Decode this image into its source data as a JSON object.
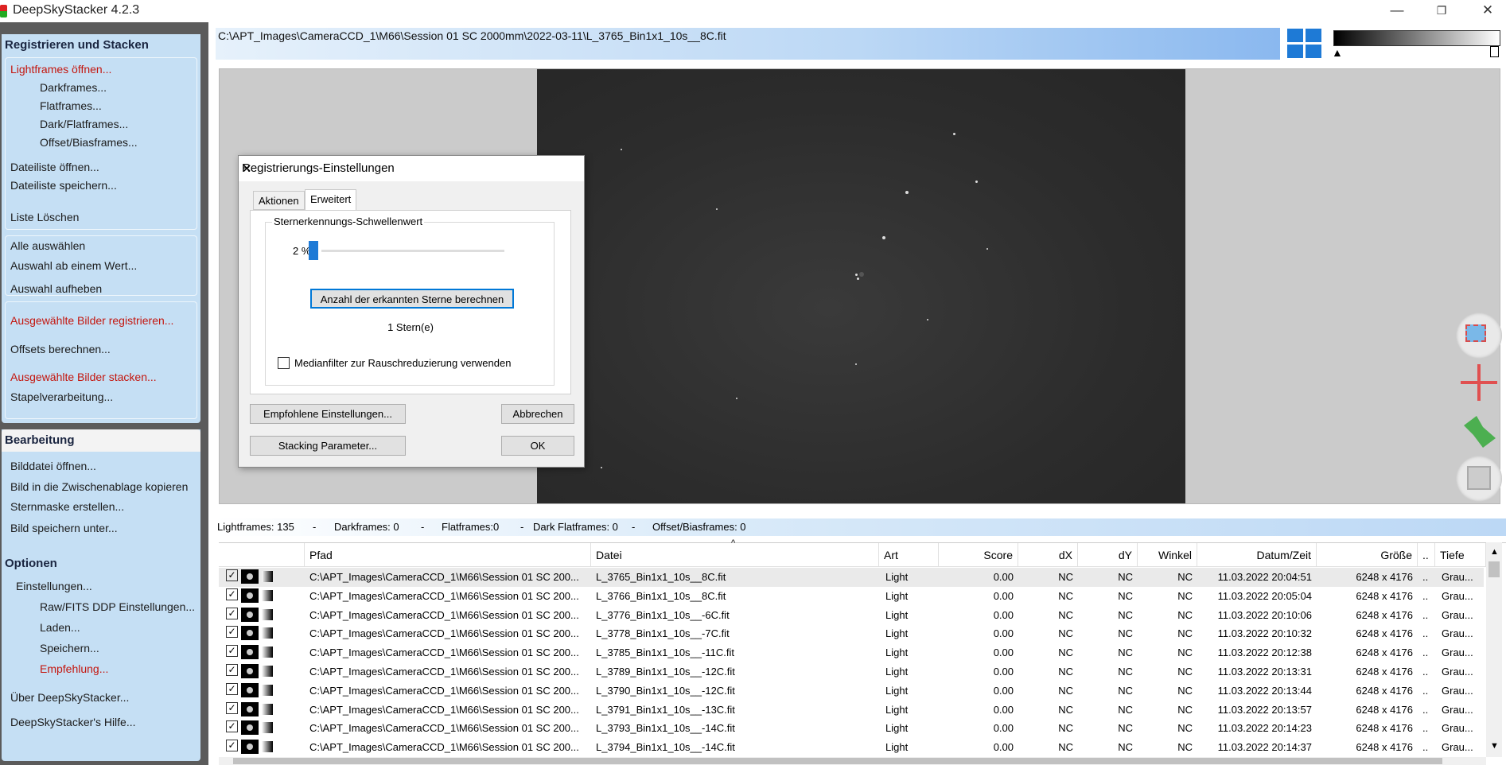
{
  "window": {
    "title": "DeepSkyStacker 4.2.3",
    "controls": [
      "—",
      "❐",
      "✕"
    ]
  },
  "left_panel": {
    "register": {
      "title": "Registrieren und Stacken",
      "open_lights": "Lightframes öffnen...",
      "darks": "Darkframes...",
      "flats": "Flatframes...",
      "darkflats": "Dark/Flatframes...",
      "offsets": "Offset/Biasframes...",
      "open_list": "Dateiliste öffnen...",
      "save_list": "Dateiliste speichern...",
      "clear_list": "Liste Löschen",
      "select_all": "Alle auswählen",
      "select_from": "Auswahl ab einem Wert...",
      "deselect": "Auswahl aufheben",
      "register_selected": "Ausgewählte Bilder registrieren...",
      "compute_offsets": "Offsets berechnen...",
      "stack_selected": "Ausgewählte Bilder stacken...",
      "batch": "Stapelverarbeitung..."
    },
    "edit": {
      "title": "Bearbeitung",
      "open_image": "Bilddatei öffnen...",
      "copy_clipboard": "Bild in die Zwischenablage kopieren",
      "star_mask": "Sternmaske erstellen...",
      "save_image": "Bild speichern unter..."
    },
    "options": {
      "title": "Optionen",
      "settings": "Einstellungen...",
      "raw_settings": "Raw/FITS DDP Einstellungen...",
      "load": "Laden...",
      "save": "Speichern...",
      "recommend": "Empfehlung...",
      "about": "Über DeepSkyStacker...",
      "help": "DeepSkyStacker's Hilfe..."
    }
  },
  "path_bar": "C:\\APT_Images\\CameraCCD_1\\M66\\Session 01 SC 2000mm\\2022-03-11\\L_3765_Bin1x1_10s__8C.fit",
  "dialog": {
    "title": "Registrierungs-Einstellungen",
    "tab_actions": "Aktionen",
    "tab_advanced": "Erweitert",
    "group_title": "Sternerkennungs-Schwellenwert",
    "threshold_value": "2 %",
    "threshold_level": 0.02,
    "compute_button": "Anzahl der erkannten Sterne berechnen",
    "stars_result": "1 Stern(e)",
    "median_filter": "Medianfilter zur Rauschreduzierung verwenden",
    "recommended_button": "Empfohlene Einstellungen...",
    "cancel_button": "Abbrechen",
    "stacking_button": "Stacking Parameter...",
    "ok_button": "OK"
  },
  "status": {
    "lights": "Lightframes: 135",
    "darks": "Darkframes: 0",
    "flats": "Flatframes:0",
    "darkflats": "Dark Flatframes: 0",
    "offsets": "Offset/Biasframes: 0",
    "sep": "-"
  },
  "table": {
    "headers": {
      "path": "Pfad",
      "file": "Datei",
      "type": "Art",
      "score": "Score",
      "dx": "dX",
      "dy": "dY",
      "angle": "Winkel",
      "datetime": "Datum/Zeit",
      "size": "Größe",
      "more": "..",
      "depth": "Tiefe"
    },
    "rows": [
      {
        "path": "C:\\APT_Images\\CameraCCD_1\\M66\\Session 01 SC 200...",
        "file": "L_3765_Bin1x1_10s__8C.fit",
        "type": "Light",
        "score": "0.00",
        "dx": "NC",
        "dy": "NC",
        "angle": "NC",
        "datetime": "11.03.2022 20:04:51",
        "size": "6248 x 4176",
        "more": "..",
        "depth": "Grau..."
      },
      {
        "path": "C:\\APT_Images\\CameraCCD_1\\M66\\Session 01 SC 200...",
        "file": "L_3766_Bin1x1_10s__8C.fit",
        "type": "Light",
        "score": "0.00",
        "dx": "NC",
        "dy": "NC",
        "angle": "NC",
        "datetime": "11.03.2022 20:05:04",
        "size": "6248 x 4176",
        "more": "..",
        "depth": "Grau..."
      },
      {
        "path": "C:\\APT_Images\\CameraCCD_1\\M66\\Session 01 SC 200...",
        "file": "L_3776_Bin1x1_10s__-6C.fit",
        "type": "Light",
        "score": "0.00",
        "dx": "NC",
        "dy": "NC",
        "angle": "NC",
        "datetime": "11.03.2022 20:10:06",
        "size": "6248 x 4176",
        "more": "..",
        "depth": "Grau..."
      },
      {
        "path": "C:\\APT_Images\\CameraCCD_1\\M66\\Session 01 SC 200...",
        "file": "L_3778_Bin1x1_10s__-7C.fit",
        "type": "Light",
        "score": "0.00",
        "dx": "NC",
        "dy": "NC",
        "angle": "NC",
        "datetime": "11.03.2022 20:10:32",
        "size": "6248 x 4176",
        "more": "..",
        "depth": "Grau..."
      },
      {
        "path": "C:\\APT_Images\\CameraCCD_1\\M66\\Session 01 SC 200...",
        "file": "L_3785_Bin1x1_10s__-11C.fit",
        "type": "Light",
        "score": "0.00",
        "dx": "NC",
        "dy": "NC",
        "angle": "NC",
        "datetime": "11.03.2022 20:12:38",
        "size": "6248 x 4176",
        "more": "..",
        "depth": "Grau..."
      },
      {
        "path": "C:\\APT_Images\\CameraCCD_1\\M66\\Session 01 SC 200...",
        "file": "L_3789_Bin1x1_10s__-12C.fit",
        "type": "Light",
        "score": "0.00",
        "dx": "NC",
        "dy": "NC",
        "angle": "NC",
        "datetime": "11.03.2022 20:13:31",
        "size": "6248 x 4176",
        "more": "..",
        "depth": "Grau..."
      },
      {
        "path": "C:\\APT_Images\\CameraCCD_1\\M66\\Session 01 SC 200...",
        "file": "L_3790_Bin1x1_10s__-12C.fit",
        "type": "Light",
        "score": "0.00",
        "dx": "NC",
        "dy": "NC",
        "angle": "NC",
        "datetime": "11.03.2022 20:13:44",
        "size": "6248 x 4176",
        "more": "..",
        "depth": "Grau..."
      },
      {
        "path": "C:\\APT_Images\\CameraCCD_1\\M66\\Session 01 SC 200...",
        "file": "L_3791_Bin1x1_10s__-13C.fit",
        "type": "Light",
        "score": "0.00",
        "dx": "NC",
        "dy": "NC",
        "angle": "NC",
        "datetime": "11.03.2022 20:13:57",
        "size": "6248 x 4176",
        "more": "..",
        "depth": "Grau..."
      },
      {
        "path": "C:\\APT_Images\\CameraCCD_1\\M66\\Session 01 SC 200...",
        "file": "L_3793_Bin1x1_10s__-14C.fit",
        "type": "Light",
        "score": "0.00",
        "dx": "NC",
        "dy": "NC",
        "angle": "NC",
        "datetime": "11.03.2022 20:14:23",
        "size": "6248 x 4176",
        "more": "..",
        "depth": "Grau..."
      },
      {
        "path": "C:\\APT_Images\\CameraCCD_1\\M66\\Session 01 SC 200...",
        "file": "L_3794_Bin1x1_10s__-14C.fit",
        "type": "Light",
        "score": "0.00",
        "dx": "NC",
        "dy": "NC",
        "angle": "NC",
        "datetime": "11.03.2022 20:14:37",
        "size": "6248 x 4176",
        "more": "..",
        "depth": "Grau..."
      }
    ]
  },
  "colors": {
    "panel_bg": "#c5dff4",
    "red_link": "#c4160e",
    "accent": "#1e7ad6"
  }
}
